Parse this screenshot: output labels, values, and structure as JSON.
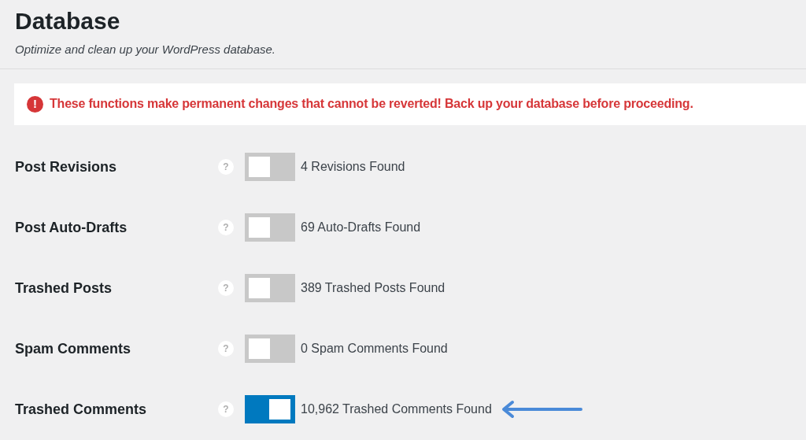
{
  "title": "Database",
  "subtitle": "Optimize and clean up your WordPress database.",
  "warning": {
    "icon": "!",
    "text": "These functions make permanent changes that cannot be reverted! Back up your database before proceeding."
  },
  "rows": [
    {
      "label": "Post Revisions",
      "help": "?",
      "on": false,
      "status": "4 Revisions Found",
      "highlighted": false
    },
    {
      "label": "Post Auto-Drafts",
      "help": "?",
      "on": false,
      "status": "69 Auto-Drafts Found",
      "highlighted": false
    },
    {
      "label": "Trashed Posts",
      "help": "?",
      "on": false,
      "status": "389 Trashed Posts Found",
      "highlighted": false
    },
    {
      "label": "Spam Comments",
      "help": "?",
      "on": false,
      "status": "0 Spam Comments Found",
      "highlighted": false
    },
    {
      "label": "Trashed Comments",
      "help": "?",
      "on": true,
      "status": "10,962 Trashed Comments Found",
      "highlighted": true
    }
  ]
}
